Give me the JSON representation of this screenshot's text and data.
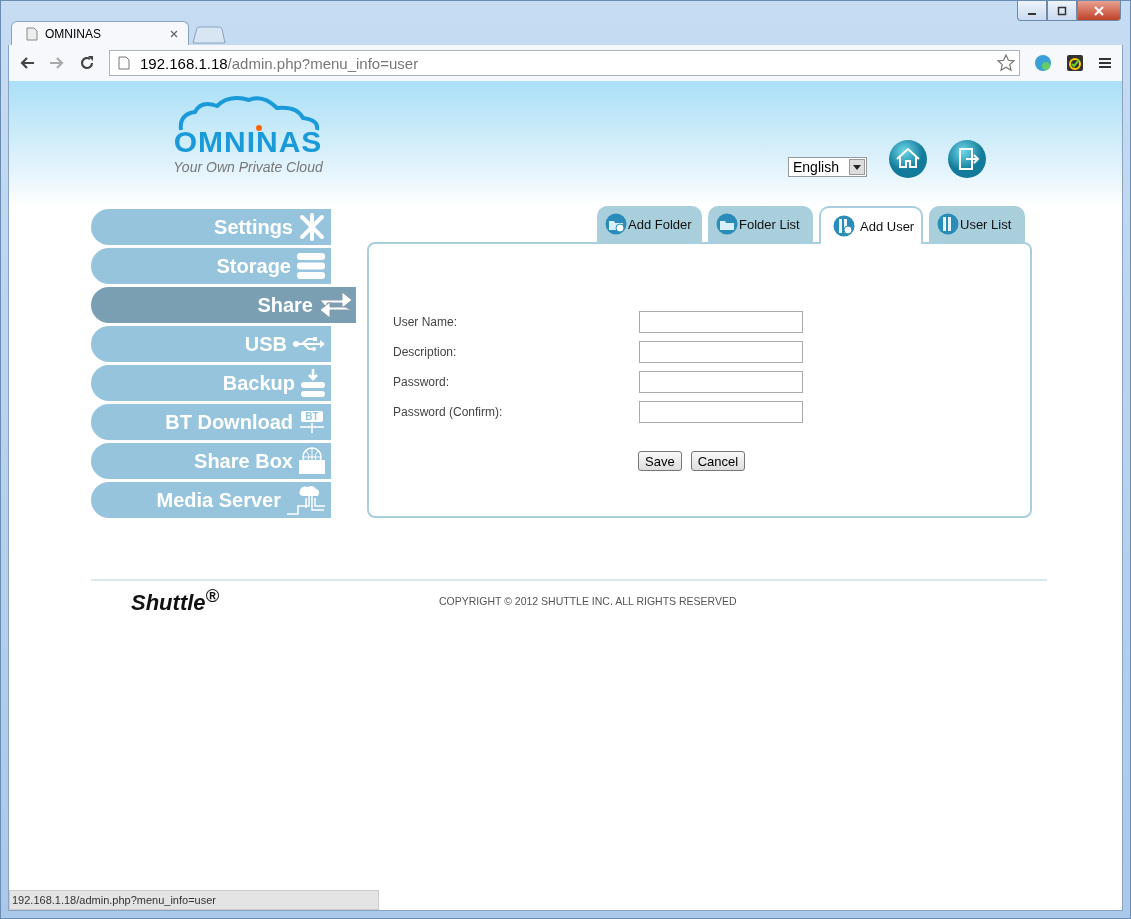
{
  "browser": {
    "tabs": [
      {
        "title": "OMNINAS",
        "selected": true
      }
    ],
    "url_host": "192.168.1.18",
    "url_path": "/admin.php?menu_info=user",
    "status": "192.168.1.18/admin.php?menu_info=user"
  },
  "logo": {
    "name": "OMNINAS",
    "tagline": "Your Own Private Cloud"
  },
  "language": "English",
  "menu": [
    {
      "label": "Settings",
      "selected": false
    },
    {
      "label": "Storage",
      "selected": false
    },
    {
      "label": "Share",
      "selected": true
    },
    {
      "label": "USB",
      "selected": false
    },
    {
      "label": "Backup",
      "selected": false
    },
    {
      "label": "BT Download",
      "selected": false,
      "badge": "BT"
    },
    {
      "label": "Share Box",
      "selected": false
    },
    {
      "label": "Media Server",
      "selected": false
    }
  ],
  "tabs": [
    {
      "label": "Add Folder",
      "selected": false
    },
    {
      "label": "Folder List",
      "selected": false
    },
    {
      "label": "Add User",
      "selected": true
    },
    {
      "label": "User List",
      "selected": false
    }
  ],
  "form": {
    "fields": [
      {
        "label": "User Name:"
      },
      {
        "label": "Description:"
      },
      {
        "label": "Password:"
      },
      {
        "label": "Password (Confirm):"
      }
    ],
    "buttons": [
      "Save",
      "Cancel"
    ]
  },
  "footer": {
    "brand": "Shuttle$^{®}$",
    "copyright": "COPYRIGHT © 2012 SHUTTLE INC. ALL RIGHTS RESERVED"
  }
}
